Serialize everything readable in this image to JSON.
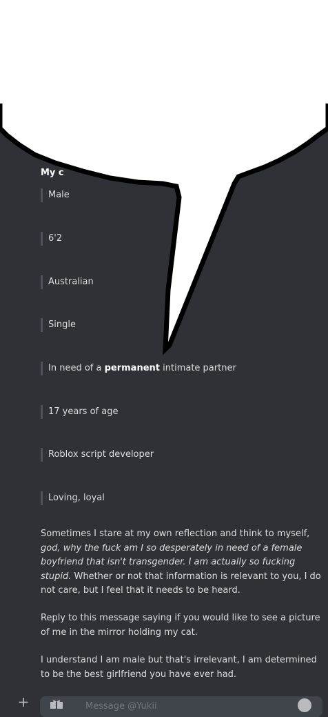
{
  "message": {
    "heading": "My c",
    "traits": [
      "Male",
      "6'2",
      "Australian",
      "Single",
      "17 years of age",
      "Roblox script developer",
      "Loving, loyal"
    ],
    "partner_line": {
      "before": "In need of a ",
      "bold": "permanent",
      "after": " intimate partner"
    },
    "paragraph1": {
      "intro": "Sometimes I stare at my own reflection and think to myself, ",
      "italic": "god, why the fuck am I so desperately in need of a female boyfriend that isn't transgender. I am actually so fucking stupid.",
      "outro": " Whether or not that information is relevant to you, I do not care, but I feel that it needs to be heard."
    },
    "paragraph2": "Reply to this message saying if you would like to see a picture of me in the mirror holding my cat.",
    "paragraph3": "I understand I am male but that's irrelevant, I am determined to be the best girlfriend you have ever had."
  },
  "composer": {
    "plus_label": "+",
    "placeholder": "Message @Yukii",
    "icons": [
      "add-attachment-icon",
      "gift-icon",
      "emoji-icon"
    ]
  },
  "overlay": {
    "type": "speech-bubble",
    "fill": "#ffffff",
    "stroke": "#000000"
  }
}
